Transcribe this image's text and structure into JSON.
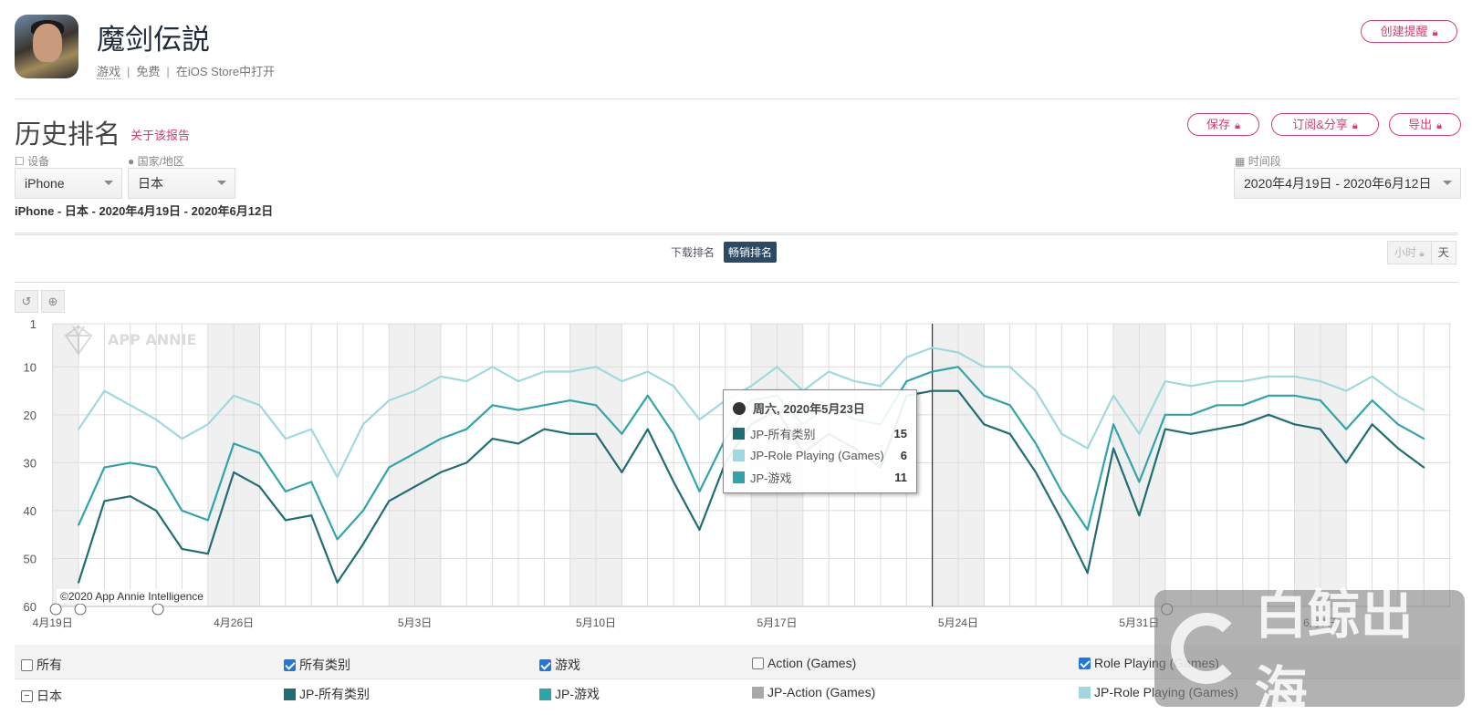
{
  "app": {
    "name": "魔剑伝説",
    "category": "游戏",
    "price": "免费",
    "store_link": "在iOS Store中打开",
    "create_alert": "创建提醒"
  },
  "report": {
    "title": "历史排名",
    "about": "关于该报告",
    "save": "保存",
    "subscribe": "订阅&分享",
    "export": "导出"
  },
  "filters": {
    "device_label": "设备",
    "device": "iPhone",
    "country_label": "国家/地区",
    "country": "日本",
    "period_label": "时间段",
    "period": "2020年4月19日 - 2020年6月12日"
  },
  "summary": "iPhone - 日本 - 2020年4月19日 - 2020年6月12日",
  "rank_tabs": [
    {
      "label": "下载排名",
      "active": false
    },
    {
      "label": "畅销排名",
      "active": true
    }
  ],
  "granularity": {
    "hour": "小时",
    "day": "天",
    "selected": "天"
  },
  "colors": {
    "accent": "#d23f72",
    "tab_active": "#2c4a63"
  },
  "chart_data": {
    "type": "line",
    "y_reversed": true,
    "ylim": [
      1,
      60
    ],
    "y_ticks": [
      1,
      10,
      20,
      30,
      40,
      50,
      60
    ],
    "x_tick_labels": [
      "4月19日",
      "4月26日",
      "5月3日",
      "5月10日",
      "5月17日",
      "5月24日",
      "5月31日",
      "6月7日"
    ],
    "grid": true,
    "weekend_shading": true,
    "highlight_date": "2020-05-23",
    "x": [
      "2020-04-20",
      "2020-04-21",
      "2020-04-22",
      "2020-04-23",
      "2020-04-24",
      "2020-04-25",
      "2020-04-26",
      "2020-04-27",
      "2020-04-28",
      "2020-04-29",
      "2020-04-30",
      "2020-05-01",
      "2020-05-02",
      "2020-05-03",
      "2020-05-04",
      "2020-05-05",
      "2020-05-06",
      "2020-05-07",
      "2020-05-08",
      "2020-05-09",
      "2020-05-10",
      "2020-05-11",
      "2020-05-12",
      "2020-05-13",
      "2020-05-14",
      "2020-05-15",
      "2020-05-16",
      "2020-05-17",
      "2020-05-18",
      "2020-05-19",
      "2020-05-20",
      "2020-05-21",
      "2020-05-22",
      "2020-05-23",
      "2020-05-24",
      "2020-05-25",
      "2020-05-26",
      "2020-05-27",
      "2020-05-28",
      "2020-05-29",
      "2020-05-30",
      "2020-05-31",
      "2020-06-01",
      "2020-06-02",
      "2020-06-03",
      "2020-06-04",
      "2020-06-05",
      "2020-06-06",
      "2020-06-07",
      "2020-06-08",
      "2020-06-09",
      "2020-06-10",
      "2020-06-11"
    ],
    "series": [
      {
        "name": "JP-Role Playing (Games)",
        "color": "#9dd9de",
        "values": [
          23,
          15,
          18,
          21,
          25,
          22,
          16,
          18,
          25,
          23,
          33,
          22,
          17,
          15,
          12,
          13,
          10,
          13,
          11,
          11,
          10,
          13,
          11,
          14,
          21,
          17,
          14,
          10,
          15,
          11,
          13,
          14,
          8,
          6,
          7,
          10,
          10,
          15,
          24,
          27,
          16,
          24,
          13,
          14,
          13,
          13,
          12,
          12,
          13,
          15,
          12,
          16,
          19
        ]
      },
      {
        "name": "JP-游戏",
        "color": "#2fa5a9",
        "values": [
          43,
          31,
          30,
          31,
          40,
          42,
          26,
          28,
          36,
          34,
          46,
          40,
          31,
          28,
          25,
          23,
          18,
          19,
          18,
          17,
          18,
          24,
          16,
          24,
          36,
          25,
          17,
          16,
          22,
          18,
          21,
          22,
          13,
          11,
          10,
          16,
          18,
          26,
          36,
          44,
          22,
          34,
          20,
          20,
          18,
          18,
          16,
          16,
          17,
          23,
          17,
          22,
          25
        ]
      },
      {
        "name": "JP-所有类别",
        "color": "#1f6e73",
        "values": [
          55,
          38,
          37,
          40,
          48,
          49,
          32,
          35,
          42,
          41,
          55,
          47,
          38,
          35,
          32,
          30,
          25,
          26,
          23,
          24,
          24,
          32,
          23,
          34,
          44,
          30,
          22,
          19,
          28,
          24,
          27,
          31,
          16,
          15,
          15,
          22,
          24,
          32,
          42,
          53,
          27,
          41,
          23,
          24,
          23,
          22,
          20,
          22,
          23,
          30,
          22,
          27,
          31
        ]
      }
    ],
    "watermark": "APP ANNIE",
    "copyright": "©2020 App Annie Intelligence"
  },
  "tooltip": {
    "date": "周六, 2020年5月23日",
    "rows": [
      {
        "label": "JP-所有类别",
        "value": "15",
        "color": "#1f6e73"
      },
      {
        "label": "JP-Role Playing (Games)",
        "value": "6",
        "color": "#9dd9de"
      },
      {
        "label": "JP-游戏",
        "value": "11",
        "color": "#2fa5a9"
      }
    ]
  },
  "legend": {
    "categories": [
      {
        "label": "所有",
        "checked": false
      },
      {
        "label": "所有类别",
        "checked": true
      },
      {
        "label": "游戏",
        "checked": true
      },
      {
        "label": "Action (Games)",
        "checked": false
      },
      {
        "label": "Role Playing (Games)",
        "checked": true
      }
    ],
    "country": "日本",
    "series": [
      {
        "label": "JP-所有类别",
        "color": "#1f6e73"
      },
      {
        "label": "JP-游戏",
        "color": "#2fa5a9"
      },
      {
        "label": "JP-Action (Games)",
        "color": "#a9a9a9"
      },
      {
        "label": "JP-Role Playing (Games)",
        "color": "#9dd9de"
      }
    ]
  },
  "overlay_logo": "白鲸出海"
}
